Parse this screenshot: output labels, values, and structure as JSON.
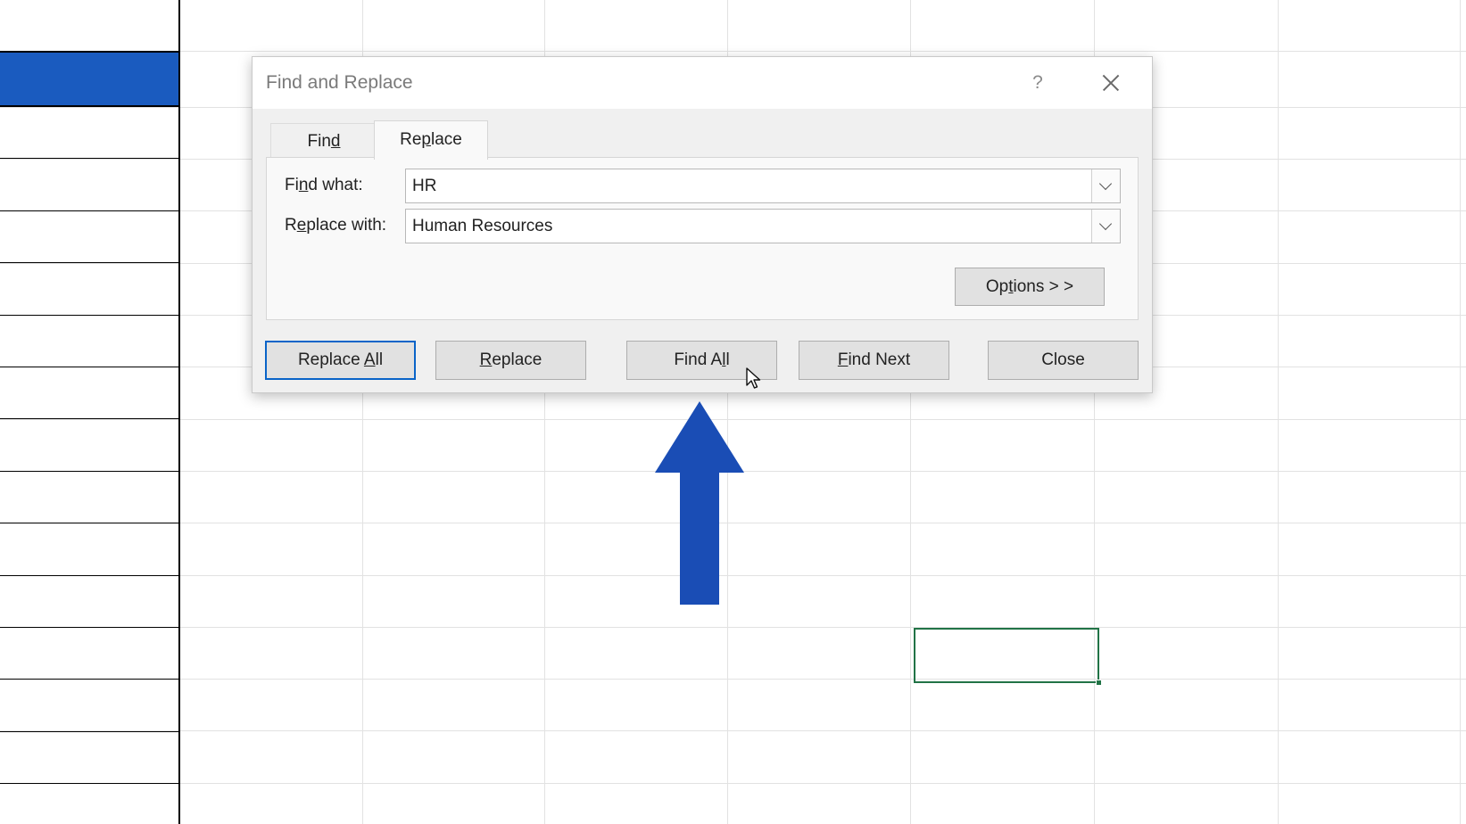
{
  "dialog": {
    "title": "Find and Replace",
    "help_label": "?",
    "close_icon": "close-icon"
  },
  "tabs": {
    "find": {
      "before": "Fin",
      "mnemonic": "d",
      "after": ""
    },
    "replace": {
      "before": "Re",
      "mnemonic": "p",
      "after": "lace"
    }
  },
  "fields": {
    "find_what": {
      "label_before": "Fi",
      "label_mnemonic": "n",
      "label_after": "d what:",
      "value": "HR"
    },
    "replace_with": {
      "label_before": "R",
      "label_mnemonic": "e",
      "label_after": "place with:",
      "value": "Human Resources"
    }
  },
  "options_button": {
    "before": "Op",
    "mnemonic": "t",
    "after": "ions > >"
  },
  "buttons": {
    "replace_all": {
      "before": "Replace ",
      "mnemonic": "A",
      "after": "ll"
    },
    "replace": {
      "before": "",
      "mnemonic": "R",
      "after": "eplace"
    },
    "find_all": {
      "before": "Find A",
      "mnemonic": "l",
      "after": "l"
    },
    "find_next": {
      "before": "",
      "mnemonic": "F",
      "after": "ind Next"
    },
    "close": {
      "before": "",
      "mnemonic": "",
      "after": "Close"
    }
  },
  "colors": {
    "accent_blue": "#1a4db5",
    "selected_cell_border": "#217346",
    "header_fill": "#1a5bbf"
  },
  "annotation": {
    "icon": "up-arrow-icon"
  }
}
